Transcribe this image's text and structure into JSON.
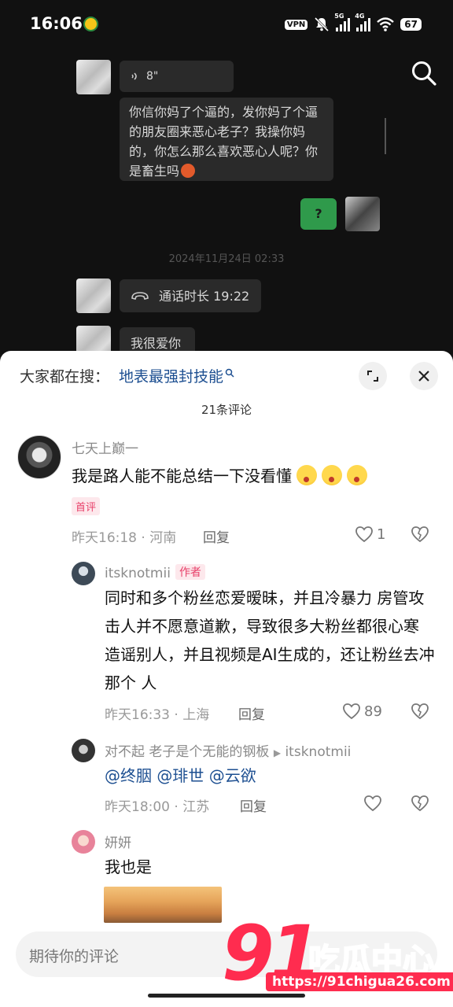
{
  "status_bar": {
    "time": "16:06",
    "vpn": "VPN",
    "net1": "5G",
    "net2": "4G",
    "battery": "67"
  },
  "chat": {
    "voice_duration": "8\"",
    "message1": "你信你妈了个逼的，发你妈了个逼的朋友圈来恶心老子？我操你妈的，你怎么那么喜欢恶心人呢？你是畜生吗",
    "reply": "?",
    "timestamp": "2024年11月24日 02:33",
    "call_label": "通话时长 19:22",
    "message2": "我很爱你"
  },
  "sheet": {
    "hot_prefix": "大家都在搜：",
    "hot_term": "地表最强封技能",
    "comment_count": "21条评论"
  },
  "comments": [
    {
      "user": "七天上巅一",
      "text": "我是路人能不能总结一下没看懂",
      "badge": "首评",
      "time": "昨天16:18",
      "location": "河南",
      "reply_label": "回复",
      "likes": "1"
    },
    {
      "user": "itsknotmii",
      "author_badge": "作者",
      "text": "同时和多个粉丝恋爱暧昧，并且冷暴力 房管攻击人并不愿意道歉，导致很多大粉丝都很心寒 造谣别人，并且视频是AI生成的，还让粉丝去冲那个 人",
      "time": "昨天16:33",
      "location": "上海",
      "reply_label": "回复",
      "likes": "89"
    },
    {
      "user": "对不起 老子是个无能的钢板",
      "reply_to": "itsknotmii",
      "mentions": "@终胭 @琲世 @云欲",
      "time": "昨天18:00",
      "location": "江苏",
      "reply_label": "回复"
    },
    {
      "user": "妍妍",
      "text": "我也是"
    }
  ],
  "input": {
    "placeholder": "期待你的评论"
  },
  "watermark": {
    "number": "91",
    "name": "吃瓜中心",
    "url": "https://91chigua26.com"
  },
  "colors": {
    "link_blue": "#1d4f91",
    "badge_pink": "#e8416a",
    "wechat_green": "#2f9a4b",
    "watermark_red": "#ff2c4f"
  }
}
